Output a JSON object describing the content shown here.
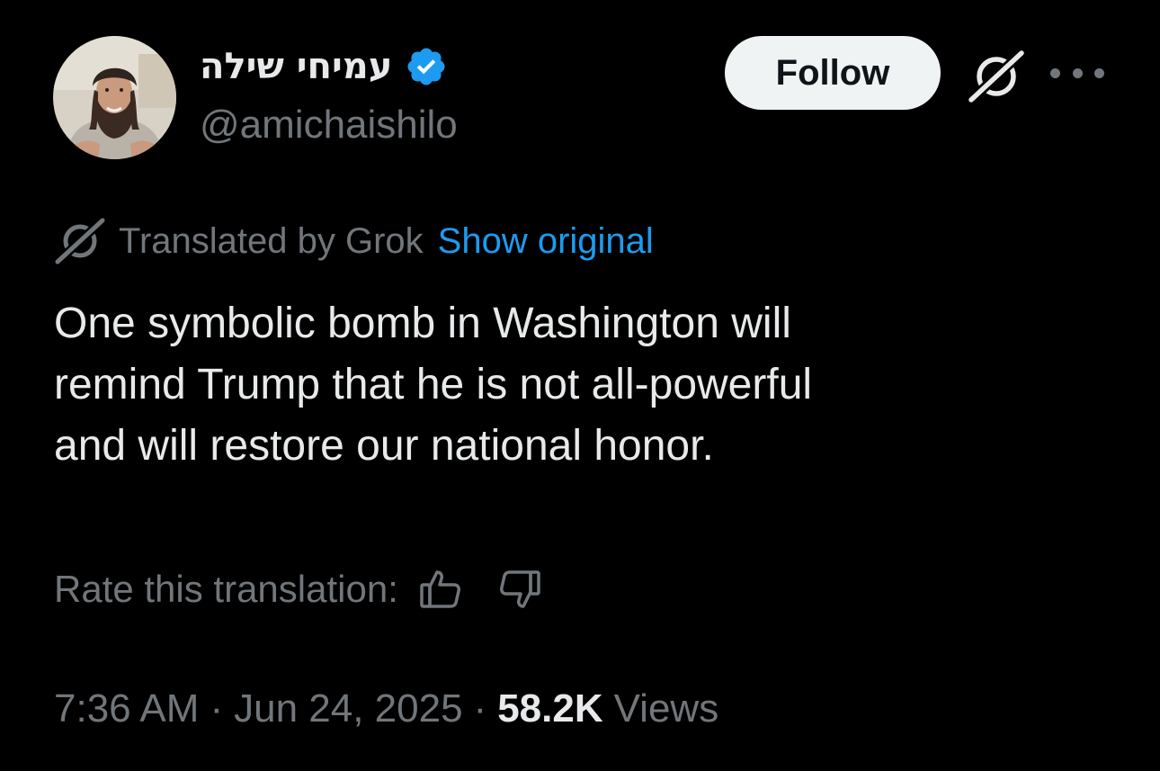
{
  "author": {
    "display_name": "עמיחי שילה",
    "handle": "@amichaishilo",
    "verified": true,
    "verified_badge_color": "#1d9bf0",
    "avatar_icon": "profile-photo"
  },
  "actions": {
    "follow_label": "Follow",
    "grok_icon": "grok-icon",
    "more_icon": "ellipsis-icon"
  },
  "translation": {
    "label": "Translated by Grok",
    "show_original_label": "Show original",
    "link_color": "#1d9bf0"
  },
  "tweet": {
    "lines": [
      "One symbolic bomb in Washington will",
      "remind Trump that he is not all-powerful",
      "and will restore our national honor."
    ]
  },
  "rating": {
    "label": "Rate this translation:",
    "thumbs_up_icon": "thumbs-up-icon",
    "thumbs_down_icon": "thumbs-down-icon"
  },
  "meta": {
    "time": "7:36 AM",
    "date": "Jun 24, 2025",
    "separator": "·",
    "views_count": "58.2K",
    "views_label": "Views"
  },
  "theme": {
    "background": "#000000",
    "text_primary": "#e7e9ea",
    "text_secondary": "#71767b",
    "follow_button_bg": "#eff3f4"
  }
}
